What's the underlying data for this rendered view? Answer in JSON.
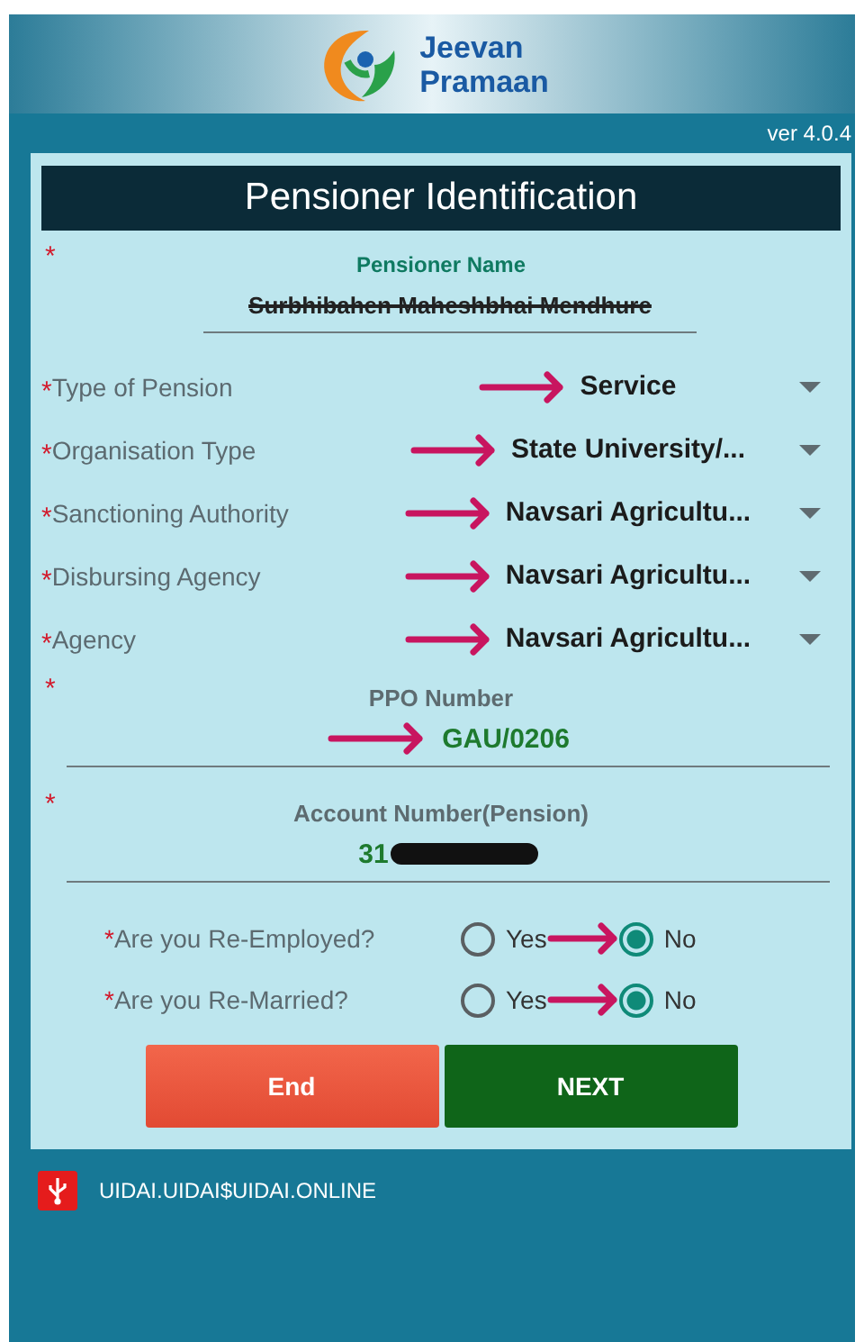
{
  "header": {
    "logo_line_1": "Jeevan",
    "logo_line_2": "Pramaan"
  },
  "version": "ver 4.0.4",
  "form": {
    "title": "Pensioner Identification",
    "name_field": {
      "marker": "*",
      "label": "Pensioner Name",
      "value": "Surbhibahen Maheshbhai Mendhure",
      "struck_out": true
    },
    "dropdowns": [
      {
        "marker": "*",
        "label": "Type of Pension",
        "value": "Service",
        "annotated": true
      },
      {
        "marker": "*",
        "label": "Organisation Type",
        "value": "State University/...",
        "annotated": true
      },
      {
        "marker": "*",
        "label": "Sanctioning Authority",
        "value": "Navsari Agricultu...",
        "annotated": true
      },
      {
        "marker": "*",
        "label": "Disbursing Agency",
        "value": "Navsari Agricultu...",
        "annotated": true
      },
      {
        "marker": "*",
        "label": "Agency",
        "value": "Navsari Agricultu...",
        "annotated": true
      }
    ],
    "text_fields": [
      {
        "marker": "*",
        "label": "PPO Number",
        "value": "GAU/0206",
        "annotated": true
      },
      {
        "marker": "*",
        "label": "Account Number(Pension)",
        "value": "31",
        "redacted": true
      }
    ],
    "questions": [
      {
        "marker": "*",
        "label": "Are you Re-Employed?",
        "options": [
          {
            "label": "Yes",
            "selected": false
          },
          {
            "label": "No",
            "selected": true
          }
        ],
        "annotated": true
      },
      {
        "marker": "*",
        "label": "Are you Re-Married?",
        "options": [
          {
            "label": "Yes",
            "selected": false
          },
          {
            "label": "No",
            "selected": true
          }
        ],
        "annotated": true
      }
    ],
    "buttons": [
      {
        "label": "End",
        "kind": "danger"
      },
      {
        "label": "NEXT",
        "kind": "primary"
      }
    ]
  },
  "footer": {
    "text": "UIDAI.UIDAI$UIDAI.ONLINE"
  }
}
